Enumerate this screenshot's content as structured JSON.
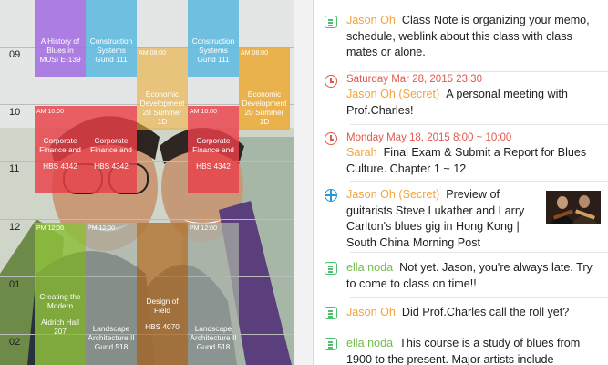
{
  "timetable": {
    "hours": [
      "09",
      "10",
      "11",
      "12",
      "01",
      "02"
    ],
    "classes": [
      {
        "key": "blues",
        "time": "",
        "lines": [
          "A History of",
          "Blues in",
          "MUSI E-139"
        ]
      },
      {
        "key": "constr1",
        "time": "",
        "lines": [
          "Construction",
          "Systems",
          "Gund 111"
        ]
      },
      {
        "key": "constr2",
        "time": "",
        "lines": [
          "Construction",
          "Systems",
          "Gund 111"
        ]
      },
      {
        "key": "econ1",
        "time": "AM 08:00",
        "lines": [
          "Economic",
          "Development",
          "20 Summer",
          "1D"
        ]
      },
      {
        "key": "econ2",
        "time": "AM 08:00",
        "lines": [
          "Economic",
          "Development",
          "20 Summer",
          "1D"
        ]
      },
      {
        "key": "corp1",
        "time": "AM 10:00",
        "lines": [
          "Corporate",
          "Finance and",
          "",
          "HBS 4342"
        ]
      },
      {
        "key": "corp2",
        "time": "",
        "lines": [
          "Corporate",
          "Finance and",
          "",
          "HBS 4342"
        ]
      },
      {
        "key": "corp3",
        "time": "AM 10:00",
        "lines": [
          "Corporate",
          "Finance and",
          "",
          "HBS 4342"
        ]
      },
      {
        "key": "modern",
        "time": "PM 12:00",
        "lines": [
          "Creating the",
          "Modern",
          "",
          "Aidrich Hall",
          "207"
        ]
      },
      {
        "key": "land1",
        "time": "PM 12:00",
        "lines": [
          "Landscape",
          "Architecture II",
          "Gund 518"
        ]
      },
      {
        "key": "design",
        "time": "",
        "lines": [
          "Design of",
          "Field",
          "",
          "HBS 4070"
        ]
      },
      {
        "key": "land2",
        "time": "PM 12:00",
        "lines": [
          "Landscape",
          "Architecture II",
          "Gund 518"
        ]
      }
    ]
  },
  "feed": [
    {
      "icon": "note-icon",
      "name": "Jason Oh",
      "name_color": "orange",
      "meta": "",
      "text": "Class Note is organizing your memo, schedule, weblink about this class with class mates or alone."
    },
    {
      "icon": "clock-icon",
      "name": "Jason Oh (Secret)",
      "name_color": "orange",
      "meta": "Saturday Mar 28, 2015 23:30",
      "text": "A personal meeting with Prof.Charles!"
    },
    {
      "icon": "clock-icon",
      "name": "Sarah",
      "name_color": "orange",
      "meta": "Monday May 18, 2015 8:00 ~ 10:00",
      "text": "Final Exam & Submit a Report for Blues Culture. Chapter 1 ~ 12"
    },
    {
      "icon": "globe-icon",
      "name": "Jason Oh (Secret)",
      "name_color": "orange",
      "meta": "",
      "text": "Preview of guitarists Steve Lukather and Larry Carlton's blues gig in Hong Kong | South China Morning Post"
    },
    {
      "icon": "note-icon",
      "name": "ella noda",
      "name_color": "green",
      "meta": "",
      "text": "Not yet. Jason, you're always late. Try to come to class on time!!"
    },
    {
      "icon": "note-icon",
      "name": "Jason Oh",
      "name_color": "orange",
      "meta": "",
      "text": "Did Prof.Charles call the roll yet?"
    },
    {
      "icon": "note-icon",
      "name": "ella noda",
      "name_color": "green",
      "meta": "",
      "text": "This course is a study of blues from 1900 to the present. Major artists include"
    }
  ],
  "colors": {
    "orange_name": "#f3a43c",
    "green_name": "#72bc4e",
    "meta": "#e0594e",
    "note": "#4cc06e",
    "globe": "#2a95d3"
  }
}
